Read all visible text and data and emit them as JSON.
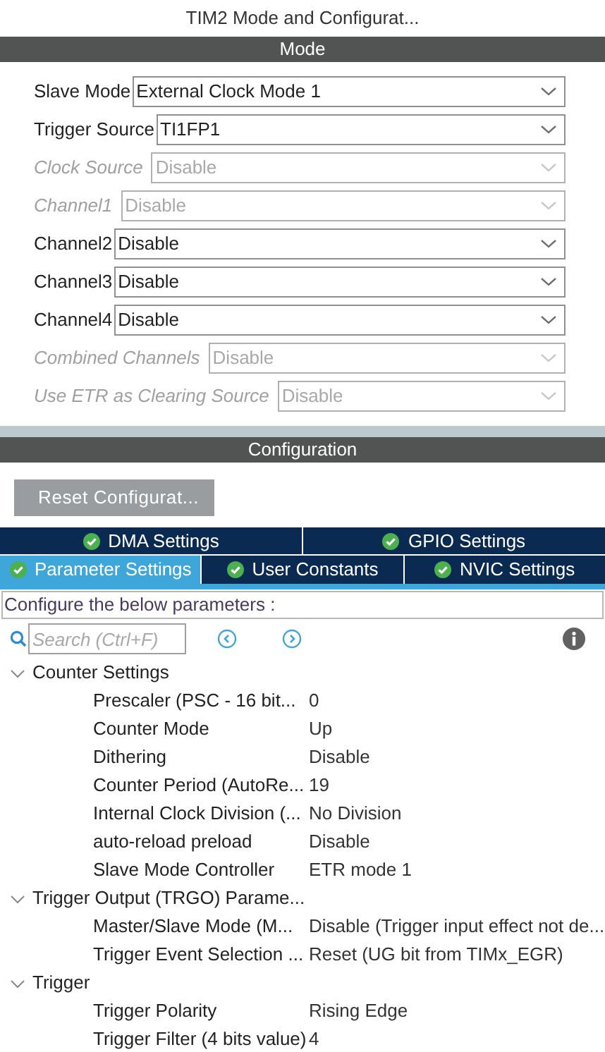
{
  "title": "TIM2 Mode and Configurat...",
  "mode": {
    "heading": "Mode",
    "fields": [
      {
        "label": "Slave Mode",
        "value": "External Clock Mode 1",
        "disabled": false
      },
      {
        "label": "Trigger Source",
        "value": "TI1FP1",
        "disabled": false
      },
      {
        "label": "Clock Source",
        "value": "Disable",
        "disabled": true
      },
      {
        "label": "Channel1",
        "value": "Disable",
        "disabled": true
      },
      {
        "label": "Channel2",
        "value": "Disable",
        "disabled": false
      },
      {
        "label": "Channel3",
        "value": "Disable",
        "disabled": false
      },
      {
        "label": "Channel4",
        "value": "Disable",
        "disabled": false
      },
      {
        "label": "Combined Channels",
        "value": "Disable",
        "disabled": true
      },
      {
        "label": "Use ETR as Clearing Source",
        "value": "Disable",
        "disabled": true
      }
    ]
  },
  "configuration": {
    "heading": "Configuration",
    "reset_button": "Reset Configurat...",
    "tab_rows": [
      [
        {
          "label": "DMA Settings",
          "selected": false
        },
        {
          "label": "GPIO Settings",
          "selected": false
        }
      ],
      [
        {
          "label": "Parameter Settings",
          "selected": true
        },
        {
          "label": "User Constants",
          "selected": false
        },
        {
          "label": "NVIC Settings",
          "selected": false
        }
      ]
    ],
    "instructions": "Configure the below parameters :",
    "search": {
      "placeholder": "Search (Ctrl+F)"
    },
    "tree": [
      {
        "label": "Counter Settings",
        "expanded": true,
        "children": [
          {
            "name": "Prescaler (PSC - 16 bit...",
            "value": "0"
          },
          {
            "name": "Counter Mode",
            "value": "Up"
          },
          {
            "name": "Dithering",
            "value": "Disable"
          },
          {
            "name": "Counter Period (AutoRe...",
            "value": "19"
          },
          {
            "name": "Internal Clock Division (...",
            "value": "No Division"
          },
          {
            "name": "auto-reload preload",
            "value": "Disable"
          },
          {
            "name": "Slave Mode Controller",
            "value": "ETR mode 1"
          }
        ]
      },
      {
        "label": "Trigger Output (TRGO) Parame...",
        "expanded": true,
        "children": [
          {
            "name": "Master/Slave Mode (M...",
            "value": "Disable (Trigger input effect not de..."
          },
          {
            "name": "Trigger Event Selection ...",
            "value": "Reset (UG bit from TIMx_EGR)"
          }
        ]
      },
      {
        "label": "Trigger",
        "expanded": true,
        "children": [
          {
            "name": "Trigger Polarity",
            "value": "Rising Edge"
          },
          {
            "name": "Trigger Filter (4 bits value)",
            "value": "4"
          }
        ]
      }
    ]
  }
}
